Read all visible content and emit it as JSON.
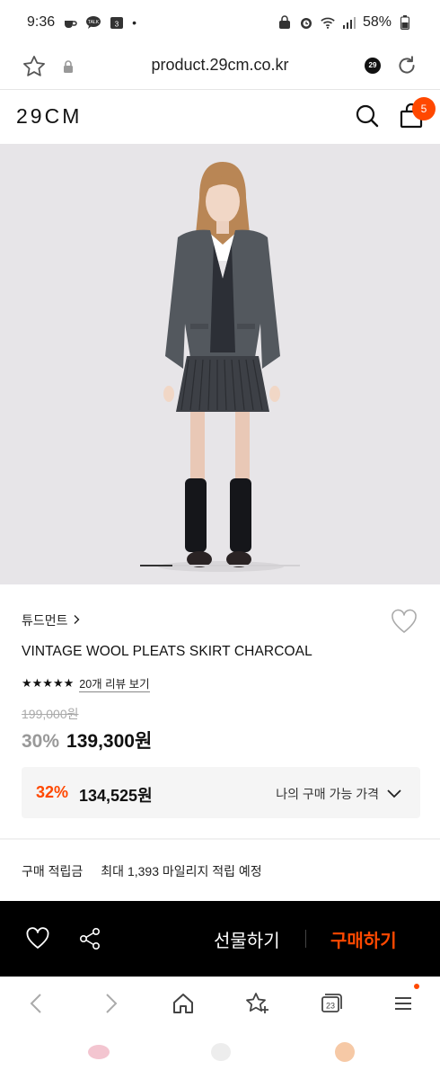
{
  "status_bar": {
    "time": "9:36",
    "battery": "58%",
    "notif_calendar": "3"
  },
  "url_bar": {
    "url": "product.29cm.co.kr",
    "tab_badge": "29"
  },
  "header": {
    "logo": "29CM",
    "cart_count": "5"
  },
  "hero": {
    "slide_progress": 0.2
  },
  "product": {
    "brand": "튜드먼트",
    "name": "VINTAGE WOOL PLEATS SKIRT CHARCOAL",
    "stars": "★★★★★",
    "review_link": "20개 리뷰 보기",
    "original_price": "199,000원",
    "discount": "30%",
    "price": "139,300원"
  },
  "my_price": {
    "discount": "32%",
    "price": "134,525원",
    "label": "나의 구매 가능 가격"
  },
  "points": {
    "label": "구매 적립금",
    "value": "최대 1,393 마일리지 적립 예정"
  },
  "buy_bar": {
    "gift_label": "선물하기",
    "buy_label": "구매하기"
  },
  "browser_nav": {
    "tabs_count": "23"
  },
  "colors": {
    "accent": "#ff4800",
    "buy_bar_bg": "#000000",
    "hero_bg": "#e7e5e8"
  }
}
